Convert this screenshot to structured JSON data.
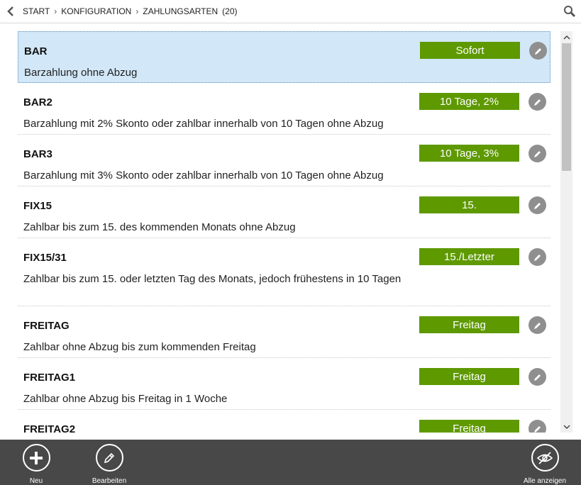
{
  "header": {
    "breadcrumb": [
      "START",
      "KONFIGURATION",
      "ZAHLUNGSARTEN"
    ],
    "count": "(20)",
    "icons": {
      "back": "chevron-left-icon",
      "search": "search-icon"
    }
  },
  "colors": {
    "badge": "#5e9900",
    "selected_row": "#d2e7f7",
    "footer": "#484848",
    "edit_button": "#8f8f8f"
  },
  "items": [
    {
      "code": "BAR",
      "description": "Barzahlung ohne Abzug",
      "badge": "Sofort"
    },
    {
      "code": "BAR2",
      "description": "Barzahlung mit 2% Skonto oder zahlbar innerhalb von 10 Tagen ohne Abzug",
      "badge": "10 Tage, 2%"
    },
    {
      "code": "BAR3",
      "description": "Barzahlung mit 3% Skonto oder zahlbar innerhalb von 10 Tagen ohne Abzug",
      "badge": "10 Tage, 3%"
    },
    {
      "code": "FIX15",
      "description": "Zahlbar bis zum 15. des kommenden Monats ohne Abzug",
      "badge": "15."
    },
    {
      "code": "FIX15/31",
      "description": "Zahlbar bis zum 15. oder letzten Tag des Monats, jedoch frühestens in 10 Tagen",
      "badge": "15./Letzter"
    },
    {
      "code": "FREITAG",
      "description": "Zahlbar ohne Abzug bis zum kommenden Freitag",
      "badge": "Freitag"
    },
    {
      "code": "FREITAG1",
      "description": "Zahlbar ohne Abzug bis Freitag in 1 Woche",
      "badge": "Freitag"
    },
    {
      "code": "FREITAG2",
      "description": "",
      "badge": "Freitag"
    }
  ],
  "footer": {
    "new_label": "Neu",
    "edit_label": "Bearbeiten",
    "show_all_label": "Alle anzeigen"
  }
}
